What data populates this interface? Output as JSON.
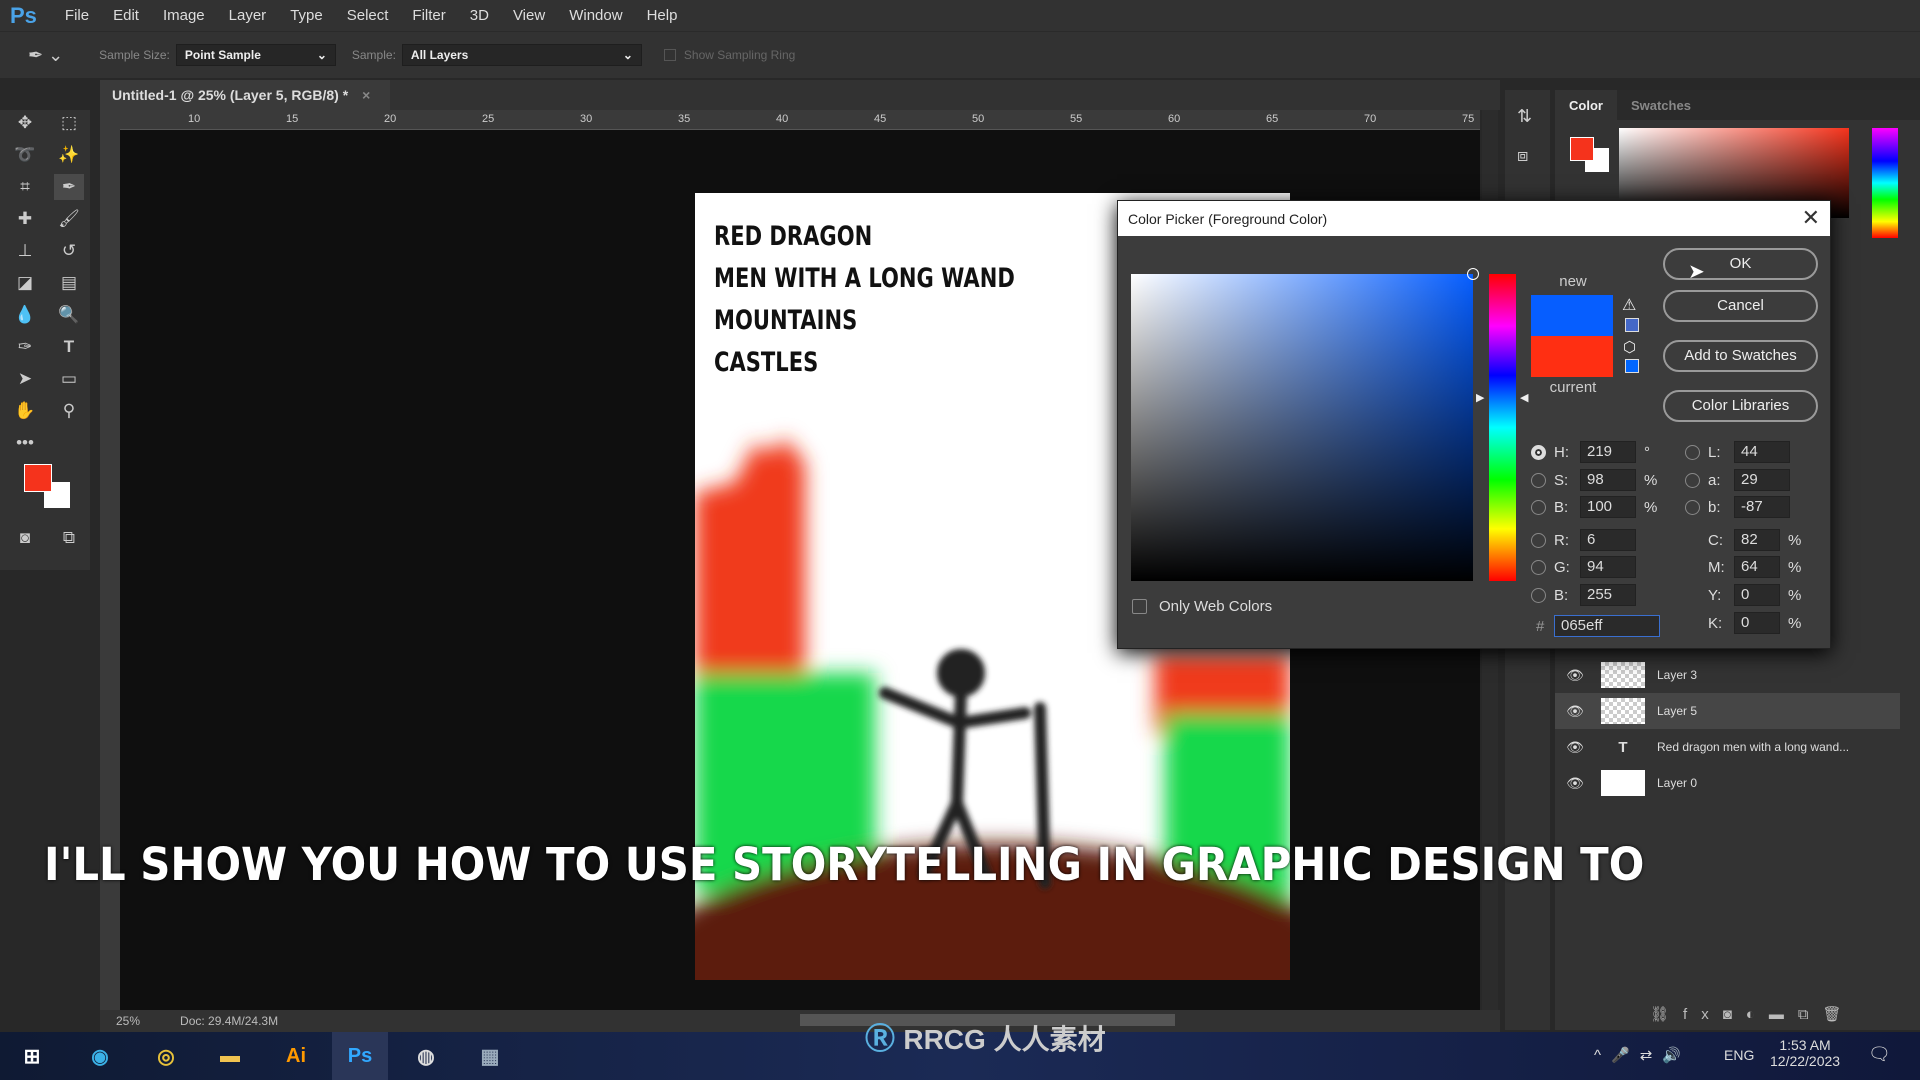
{
  "app": {
    "logo": "Ps",
    "menu": [
      "File",
      "Edit",
      "Image",
      "Layer",
      "Type",
      "Select",
      "Filter",
      "3D",
      "View",
      "Window",
      "Help"
    ]
  },
  "options": {
    "sample_size_label": "Sample Size:",
    "sample_size": "Point Sample",
    "sample_label": "Sample:",
    "sample": "All Layers",
    "ring_label": "Show Sampling Ring"
  },
  "document": {
    "tab": "Untitled-1 @ 25% (Layer 5, RGB/8) *",
    "lines": [
      "RED DRAGON",
      "MEN WITH A LONG WAND",
      "MOUNTAINS",
      "CASTLES"
    ],
    "ruler_ticks": [
      "10",
      "15",
      "20",
      "25",
      "30",
      "35",
      "40",
      "45",
      "50",
      "55",
      "60",
      "65",
      "70",
      "75"
    ]
  },
  "status": {
    "zoom": "25%",
    "doc": "Doc: 29.4M/24.3M"
  },
  "colors": {
    "foreground": "#f5331c",
    "background": "#ffffff",
    "new": "#065eff",
    "current": "#ff2f12"
  },
  "color_panel": {
    "tabs": [
      "Color",
      "Swatches"
    ]
  },
  "dialog": {
    "title": "Color Picker (Foreground Color)",
    "new_label": "new",
    "current_label": "current",
    "buttons": {
      "ok": "OK",
      "cancel": "Cancel",
      "add": "Add to Swatches",
      "libraries": "Color Libraries"
    },
    "only_web": "Only Web Colors",
    "hsb": [
      {
        "l": "H:",
        "v": "219",
        "u": "°"
      },
      {
        "l": "S:",
        "v": "98",
        "u": "%"
      },
      {
        "l": "B:",
        "v": "100",
        "u": "%"
      }
    ],
    "rgb": [
      {
        "l": "R:",
        "v": "6"
      },
      {
        "l": "G:",
        "v": "94"
      },
      {
        "l": "B:",
        "v": "255"
      }
    ],
    "lab": [
      {
        "l": "L:",
        "v": "44"
      },
      {
        "l": "a:",
        "v": "29"
      },
      {
        "l": "b:",
        "v": "-87"
      }
    ],
    "cmyk": [
      {
        "l": "C:",
        "v": "82",
        "u": "%"
      },
      {
        "l": "M:",
        "v": "64",
        "u": "%"
      },
      {
        "l": "Y:",
        "v": "0",
        "u": "%"
      },
      {
        "l": "K:",
        "v": "0",
        "u": "%"
      }
    ],
    "hex_label": "#",
    "hex": "065eff"
  },
  "layers": [
    "Layer 3",
    "Layer 5",
    "Red dragon men with a long wand...",
    "Layer 0"
  ],
  "subtitle": "I'LL SHOW YOU HOW TO USE STORYTELLING IN GRAPHIC DESIGN TO",
  "watermark": "RRCG 人人素材",
  "taskbar": {
    "lang": "ENG",
    "time": "1:53 AM",
    "date": "12/22/2023"
  }
}
